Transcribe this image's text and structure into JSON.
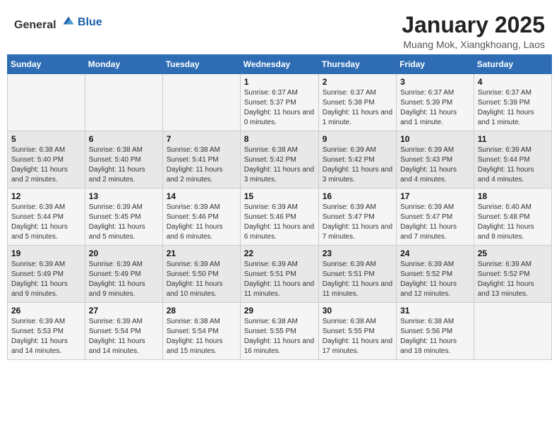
{
  "header": {
    "logo_general": "General",
    "logo_blue": "Blue",
    "title": "January 2025",
    "subtitle": "Muang Mok, Xiangkhoang, Laos"
  },
  "weekdays": [
    "Sunday",
    "Monday",
    "Tuesday",
    "Wednesday",
    "Thursday",
    "Friday",
    "Saturday"
  ],
  "weeks": [
    [
      {
        "day": "",
        "sunrise": "",
        "sunset": "",
        "daylight": ""
      },
      {
        "day": "",
        "sunrise": "",
        "sunset": "",
        "daylight": ""
      },
      {
        "day": "",
        "sunrise": "",
        "sunset": "",
        "daylight": ""
      },
      {
        "day": "1",
        "sunrise": "Sunrise: 6:37 AM",
        "sunset": "Sunset: 5:37 PM",
        "daylight": "Daylight: 11 hours and 0 minutes."
      },
      {
        "day": "2",
        "sunrise": "Sunrise: 6:37 AM",
        "sunset": "Sunset: 5:38 PM",
        "daylight": "Daylight: 11 hours and 1 minute."
      },
      {
        "day": "3",
        "sunrise": "Sunrise: 6:37 AM",
        "sunset": "Sunset: 5:39 PM",
        "daylight": "Daylight: 11 hours and 1 minute."
      },
      {
        "day": "4",
        "sunrise": "Sunrise: 6:37 AM",
        "sunset": "Sunset: 5:39 PM",
        "daylight": "Daylight: 11 hours and 1 minute."
      }
    ],
    [
      {
        "day": "5",
        "sunrise": "Sunrise: 6:38 AM",
        "sunset": "Sunset: 5:40 PM",
        "daylight": "Daylight: 11 hours and 2 minutes."
      },
      {
        "day": "6",
        "sunrise": "Sunrise: 6:38 AM",
        "sunset": "Sunset: 5:40 PM",
        "daylight": "Daylight: 11 hours and 2 minutes."
      },
      {
        "day": "7",
        "sunrise": "Sunrise: 6:38 AM",
        "sunset": "Sunset: 5:41 PM",
        "daylight": "Daylight: 11 hours and 2 minutes."
      },
      {
        "day": "8",
        "sunrise": "Sunrise: 6:38 AM",
        "sunset": "Sunset: 5:42 PM",
        "daylight": "Daylight: 11 hours and 3 minutes."
      },
      {
        "day": "9",
        "sunrise": "Sunrise: 6:39 AM",
        "sunset": "Sunset: 5:42 PM",
        "daylight": "Daylight: 11 hours and 3 minutes."
      },
      {
        "day": "10",
        "sunrise": "Sunrise: 6:39 AM",
        "sunset": "Sunset: 5:43 PM",
        "daylight": "Daylight: 11 hours and 4 minutes."
      },
      {
        "day": "11",
        "sunrise": "Sunrise: 6:39 AM",
        "sunset": "Sunset: 5:44 PM",
        "daylight": "Daylight: 11 hours and 4 minutes."
      }
    ],
    [
      {
        "day": "12",
        "sunrise": "Sunrise: 6:39 AM",
        "sunset": "Sunset: 5:44 PM",
        "daylight": "Daylight: 11 hours and 5 minutes."
      },
      {
        "day": "13",
        "sunrise": "Sunrise: 6:39 AM",
        "sunset": "Sunset: 5:45 PM",
        "daylight": "Daylight: 11 hours and 5 minutes."
      },
      {
        "day": "14",
        "sunrise": "Sunrise: 6:39 AM",
        "sunset": "Sunset: 5:46 PM",
        "daylight": "Daylight: 11 hours and 6 minutes."
      },
      {
        "day": "15",
        "sunrise": "Sunrise: 6:39 AM",
        "sunset": "Sunset: 5:46 PM",
        "daylight": "Daylight: 11 hours and 6 minutes."
      },
      {
        "day": "16",
        "sunrise": "Sunrise: 6:39 AM",
        "sunset": "Sunset: 5:47 PM",
        "daylight": "Daylight: 11 hours and 7 minutes."
      },
      {
        "day": "17",
        "sunrise": "Sunrise: 6:39 AM",
        "sunset": "Sunset: 5:47 PM",
        "daylight": "Daylight: 11 hours and 7 minutes."
      },
      {
        "day": "18",
        "sunrise": "Sunrise: 6:40 AM",
        "sunset": "Sunset: 5:48 PM",
        "daylight": "Daylight: 11 hours and 8 minutes."
      }
    ],
    [
      {
        "day": "19",
        "sunrise": "Sunrise: 6:39 AM",
        "sunset": "Sunset: 5:49 PM",
        "daylight": "Daylight: 11 hours and 9 minutes."
      },
      {
        "day": "20",
        "sunrise": "Sunrise: 6:39 AM",
        "sunset": "Sunset: 5:49 PM",
        "daylight": "Daylight: 11 hours and 9 minutes."
      },
      {
        "day": "21",
        "sunrise": "Sunrise: 6:39 AM",
        "sunset": "Sunset: 5:50 PM",
        "daylight": "Daylight: 11 hours and 10 minutes."
      },
      {
        "day": "22",
        "sunrise": "Sunrise: 6:39 AM",
        "sunset": "Sunset: 5:51 PM",
        "daylight": "Daylight: 11 hours and 11 minutes."
      },
      {
        "day": "23",
        "sunrise": "Sunrise: 6:39 AM",
        "sunset": "Sunset: 5:51 PM",
        "daylight": "Daylight: 11 hours and 11 minutes."
      },
      {
        "day": "24",
        "sunrise": "Sunrise: 6:39 AM",
        "sunset": "Sunset: 5:52 PM",
        "daylight": "Daylight: 11 hours and 12 minutes."
      },
      {
        "day": "25",
        "sunrise": "Sunrise: 6:39 AM",
        "sunset": "Sunset: 5:52 PM",
        "daylight": "Daylight: 11 hours and 13 minutes."
      }
    ],
    [
      {
        "day": "26",
        "sunrise": "Sunrise: 6:39 AM",
        "sunset": "Sunset: 5:53 PM",
        "daylight": "Daylight: 11 hours and 14 minutes."
      },
      {
        "day": "27",
        "sunrise": "Sunrise: 6:39 AM",
        "sunset": "Sunset: 5:54 PM",
        "daylight": "Daylight: 11 hours and 14 minutes."
      },
      {
        "day": "28",
        "sunrise": "Sunrise: 6:38 AM",
        "sunset": "Sunset: 5:54 PM",
        "daylight": "Daylight: 11 hours and 15 minutes."
      },
      {
        "day": "29",
        "sunrise": "Sunrise: 6:38 AM",
        "sunset": "Sunset: 5:55 PM",
        "daylight": "Daylight: 11 hours and 16 minutes."
      },
      {
        "day": "30",
        "sunrise": "Sunrise: 6:38 AM",
        "sunset": "Sunset: 5:55 PM",
        "daylight": "Daylight: 11 hours and 17 minutes."
      },
      {
        "day": "31",
        "sunrise": "Sunrise: 6:38 AM",
        "sunset": "Sunset: 5:56 PM",
        "daylight": "Daylight: 11 hours and 18 minutes."
      },
      {
        "day": "",
        "sunrise": "",
        "sunset": "",
        "daylight": ""
      }
    ]
  ]
}
